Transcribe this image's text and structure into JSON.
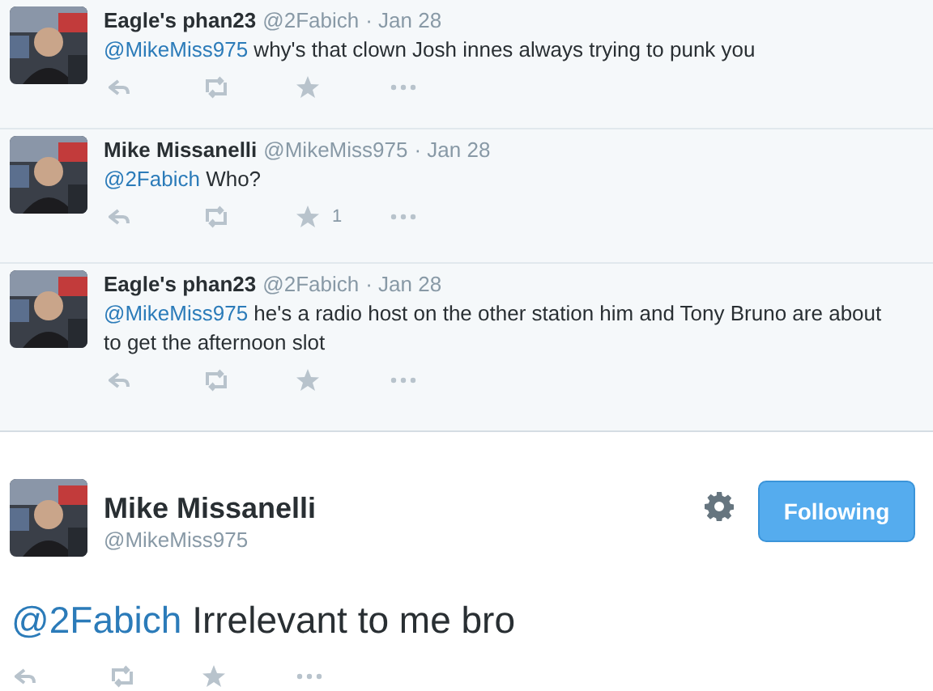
{
  "replies": [
    {
      "name": "Eagle's phan23",
      "handle": "@2Fabich",
      "date": "· Jan 28",
      "mention": "@MikeMiss975",
      "text": " why's that clown Josh innes always trying to punk you"
    },
    {
      "name": "Mike Missanelli",
      "handle": "@MikeMiss975",
      "date": "· Jan 28",
      "mention": "@2Fabich",
      "text": " Who?",
      "favorite_count": "1"
    },
    {
      "name": "Eagle's phan23",
      "handle": "@2Fabich",
      "date": "· Jan 28",
      "mention": "@MikeMiss975",
      "text": " he's a radio host on the other station him and Tony Bruno are about to get the afternoon slot"
    }
  ],
  "main_tweet": {
    "name": "Mike Missanelli",
    "handle": "@MikeMiss975",
    "follow_button": "Following",
    "mention": "@2Fabich",
    "text": " Irrelevant to me bro"
  }
}
